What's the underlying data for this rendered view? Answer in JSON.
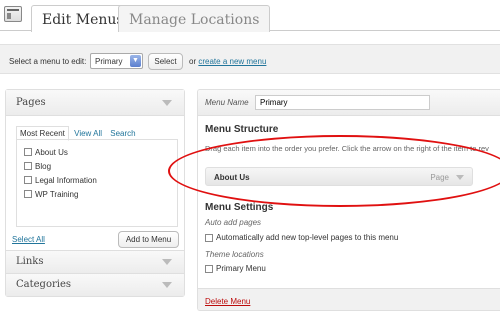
{
  "tabs": {
    "active": "Edit Menus",
    "inactive": "Manage Locations"
  },
  "select_bar": {
    "label": "Select a menu to edit:",
    "selected_menu": "Primary",
    "select_button": "Select",
    "or_text": "or",
    "create_link": "create a new menu"
  },
  "left": {
    "pages_title": "Pages",
    "subtabs": [
      "Most Recent",
      "View All",
      "Search"
    ],
    "pages": [
      "About Us",
      "Blog",
      "Legal Information",
      "WP Training"
    ],
    "select_all": "Select All",
    "add_button": "Add to Menu",
    "links_title": "Links",
    "categories_title": "Categories"
  },
  "right": {
    "menu_name_label": "Menu Name",
    "menu_name_value": "Primary",
    "structure_title": "Menu Structure",
    "structure_hint": "Drag each item into the order you prefer. Click the arrow on the right of the item to rev",
    "item_title": "About Us",
    "item_type": "Page",
    "settings_title": "Menu Settings",
    "auto_add_label": "Auto add pages",
    "auto_add_option": "Automatically add new top-level pages to this menu",
    "theme_locations_label": "Theme locations",
    "primary_menu_option": "Primary Menu",
    "delete_link": "Delete Menu"
  },
  "colors": {
    "link": "#21759b",
    "delete": "#bc0b0b",
    "annotation": "#e01010"
  }
}
